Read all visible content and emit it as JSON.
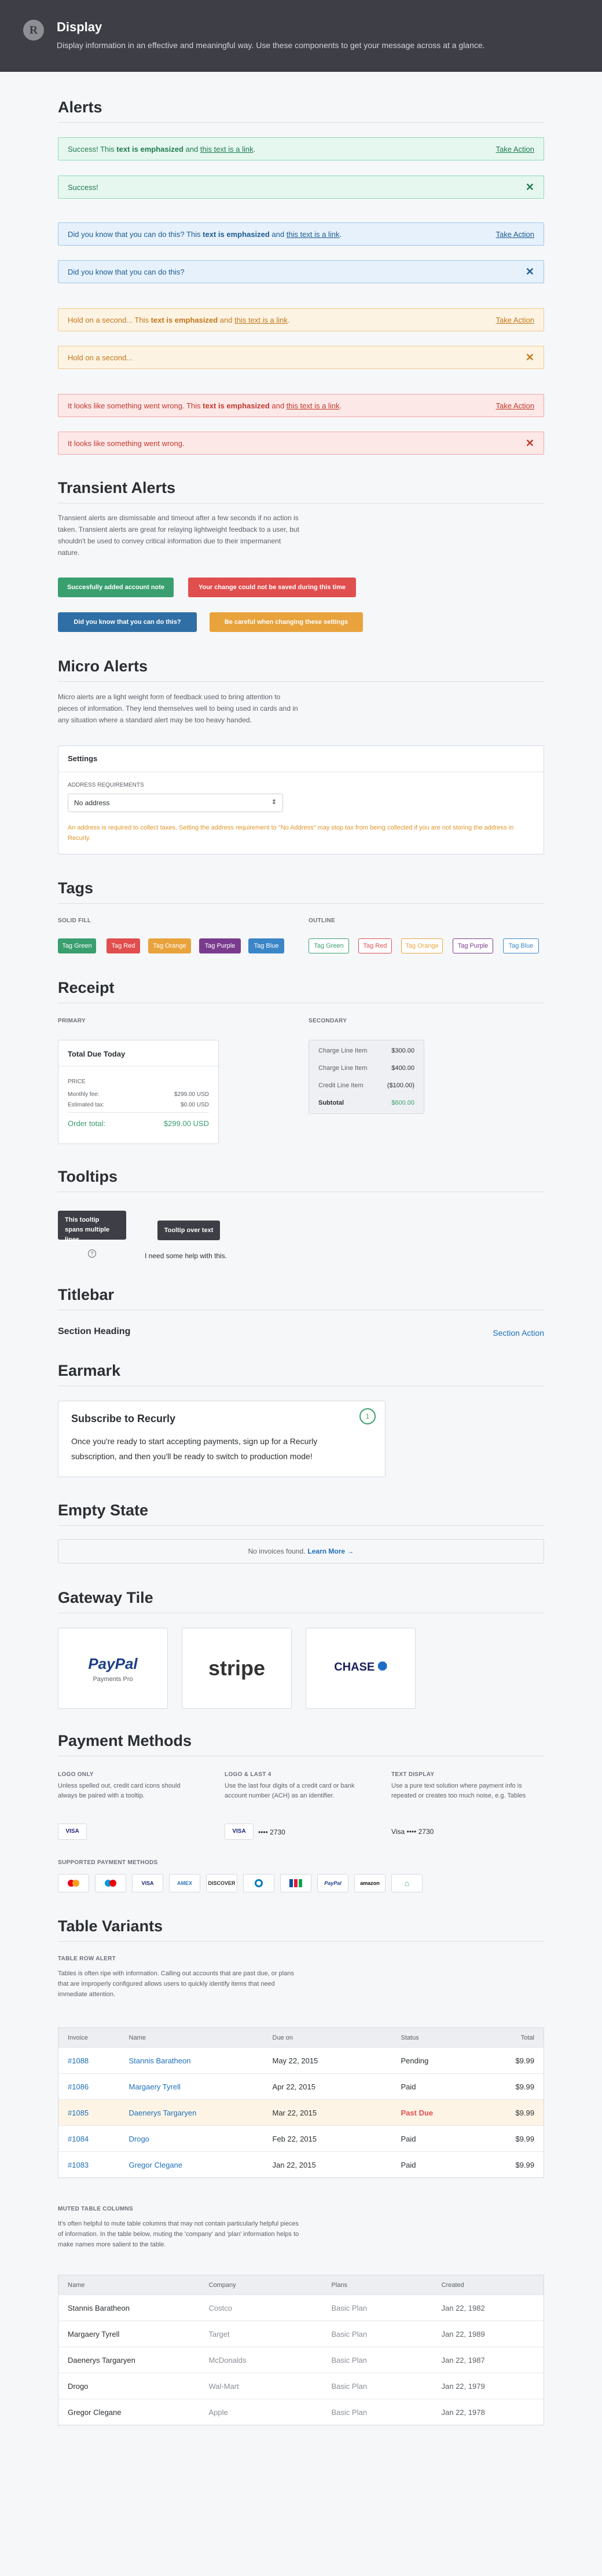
{
  "header": {
    "logo": "R",
    "title": "Display",
    "subtitle": "Display information in an effective and meaningful way. Use these components to get your message across at a glance."
  },
  "sections": {
    "alerts": "Alerts",
    "transient": "Transient Alerts",
    "micro": "Micro Alerts",
    "tags": "Tags",
    "receipt": "Receipt",
    "tooltips": "Tooltips",
    "titlebar": "Titlebar",
    "earmark": "Earmark",
    "empty": "Empty State",
    "gateway": "Gateway Tile",
    "payment": "Payment Methods",
    "tables": "Table Variants"
  },
  "alerts": {
    "success_pre": "Success! This ",
    "success_em": "text is emphasized",
    "success_mid": " and ",
    "success_link": "this text is a link",
    "success_end": ".",
    "success_action": "Take Action",
    "success_short": "Success!",
    "info_pre": "Did you know that you can do this? This ",
    "info_em": "text is emphasized",
    "info_mid": " and ",
    "info_link": "this text is a link",
    "info_end": ".",
    "info_action": "Take Action",
    "info_short": "Did you know that you can do this?",
    "warn_pre": "Hold on a second... This ",
    "warn_em": "text is emphasized",
    "warn_mid": " and ",
    "warn_link": "this text is a link",
    "warn_end": ".",
    "warn_action": "Take Action",
    "warn_short": "Hold on a second...",
    "danger_pre": "It looks like something went wrong.  This ",
    "danger_em": "text is emphasized",
    "danger_mid": " and ",
    "danger_link": "this text is a link",
    "danger_end": ".",
    "danger_action": "Take Action",
    "danger_short": "It looks like something went wrong.",
    "close": "✕"
  },
  "transient": {
    "desc": "Transient alerts are dismissable and timeout after a few seconds if no action is taken. Transient alerts are great for relaying lightweight feedback to a user, but shouldn't be used to convey critical information due to their impermanent nature.",
    "btn_success": "Succesfully added account note",
    "btn_danger": "Your change could not be saved during this time",
    "btn_info": "Did you know that you can do this?",
    "btn_warn": "Be careful when changing these settings"
  },
  "micro": {
    "desc": "Micro alerts are a light weight form of feedback used to bring attention to pieces of information. They lend themselves well to being used in cards and in any situation where a standard alert may be too heavy handed.",
    "card_title": "Settings",
    "field_label": "ADDRESS REQUIREMENTS",
    "select_value": "No address",
    "warning": "An address is required to collect taxes. Setting the address requirement to \"No Address\" may stop tax from being collected if you are not storing the address in Recurly."
  },
  "tags": {
    "solid_label": "SOLID FILL",
    "outline_label": "OUTLINE",
    "solid": [
      "Tag Green",
      "Tag Red",
      "Tag Orange",
      "Tag Purple",
      "Tag Blue"
    ],
    "outline": [
      "Tag Green",
      "Tag Red",
      "Tag Orange",
      "Tag Purple",
      "Tag Blue"
    ]
  },
  "receipt": {
    "primary_label": "PRIMARY",
    "secondary_label": "SECONDARY",
    "title": "Total Due Today",
    "price_label": "PRICE",
    "rows": [
      {
        "label": "Monthly fee:",
        "value": "$299.00 USD"
      },
      {
        "label": "Estimated tax:",
        "value": "$0.00 USD"
      }
    ],
    "total_label": "Order total:",
    "total_value": "$299.00 USD",
    "sec_rows": [
      {
        "label": "Charge Line Item",
        "value": "$300.00"
      },
      {
        "label": "Charge Line Item",
        "value": "$400.00"
      },
      {
        "label": "Credit Line Item",
        "value": "($100.00)"
      }
    ],
    "subtotal_label": "Subtotal",
    "subtotal_value": "$600.00"
  },
  "tooltips": {
    "multi": "This tooltip spans multiple lines.",
    "over": "Tooltip over text",
    "help_text": "I need some help with this.",
    "help_icon": "?"
  },
  "titlebar": {
    "heading": "Section Heading",
    "action": "Section Action"
  },
  "earmark": {
    "title": "Subscribe to Recurly",
    "body": "Once you're ready to start accepting payments, sign up for a Recurly subscription, and then you'll be ready to switch to production mode!",
    "step": "1"
  },
  "empty": {
    "text": "No invoices found. ",
    "link": "Learn More →"
  },
  "gateway": {
    "paypal": "PayPal",
    "paypal_sub": "Payments Pro",
    "stripe": "stripe",
    "chase": "CHASE"
  },
  "payment": {
    "logo_label": "LOGO ONLY",
    "logo_desc": "Unless spelled out, credit card icons should always be paired with a tooltip.",
    "logo4_label": "LOGO & LAST 4",
    "logo4_desc": "Use the last four digits of a credit card or bank account number (ACH) as an identifier.",
    "text_label": "TEXT DISPLAY",
    "text_desc": "Use a pure text solution where payment info is repeated or creates too much noise, e.g. Tables",
    "visa": "VISA",
    "last4": "•••• 2730",
    "text_visa": "Visa •••• 2730",
    "supported_label": "SUPPORTED PAYMENT METHODS",
    "methods": [
      "MC",
      "MAESTRO",
      "VISA",
      "AMEX",
      "DISCOVER",
      "DINERS",
      "JCB",
      "PayPal",
      "amazon",
      "BANK"
    ]
  },
  "table1": {
    "label": "TABLE ROW ALERT",
    "desc": "Tables is often ripe with information. Calling out accounts that are past due, or plans that are improperly configured allows users to quickly identify items that need immediate attention.",
    "headers": [
      "Invoice",
      "Name",
      "Due on",
      "Status",
      "Total"
    ],
    "rows": [
      {
        "invoice": "#1088",
        "name": "Stannis Baratheon",
        "due": "May 22, 2015",
        "status": "Pending",
        "total": "$9.99"
      },
      {
        "invoice": "#1086",
        "name": "Margaery Tyrell",
        "due": "Apr 22, 2015",
        "status": "Paid",
        "total": "$9.99"
      },
      {
        "invoice": "#1085",
        "name": "Daenerys Targaryen",
        "due": "Mar 22, 2015",
        "status": "Past Due",
        "total": "$9.99"
      },
      {
        "invoice": "#1084",
        "name": "Drogo",
        "due": "Feb 22, 2015",
        "status": "Paid",
        "total": "$9.99"
      },
      {
        "invoice": "#1083",
        "name": "Gregor Clegane",
        "due": "Jan 22, 2015",
        "status": "Paid",
        "total": "$9.99"
      }
    ]
  },
  "table2": {
    "label": "MUTED TABLE COLUMNS",
    "desc": "It's often helpful to mute table columns that may not contain particularly helpful pieces of information. In the table below, muting the 'company' and 'plan' information helps to make names more salient to the table.",
    "headers": [
      "Name",
      "Company",
      "Plans",
      "Created"
    ],
    "rows": [
      {
        "name": "Stannis Baratheon",
        "company": "Costco",
        "plan": "Basic Plan",
        "created": "Jan 22, 1982"
      },
      {
        "name": "Margaery Tyrell",
        "company": "Target",
        "plan": "Basic Plan",
        "created": "Jan 22, 1989"
      },
      {
        "name": "Daenerys Targaryen",
        "company": "McDonalds",
        "plan": "Basic Plan",
        "created": "Jan 22, 1987"
      },
      {
        "name": "Drogo",
        "company": "Wal-Mart",
        "plan": "Basic Plan",
        "created": "Jan 22, 1979"
      },
      {
        "name": "Gregor Clegane",
        "company": "Apple",
        "plan": "Basic Plan",
        "created": "Jan 22, 1978"
      }
    ]
  },
  "colors": {
    "header": "#3d3e46",
    "green": "#3a9f6f",
    "red": "#e04e4e",
    "blue": "#2f6fa5",
    "orange": "#e8a33d",
    "purple": "#7a3b8f",
    "tag_blue": "#3b86c7"
  }
}
